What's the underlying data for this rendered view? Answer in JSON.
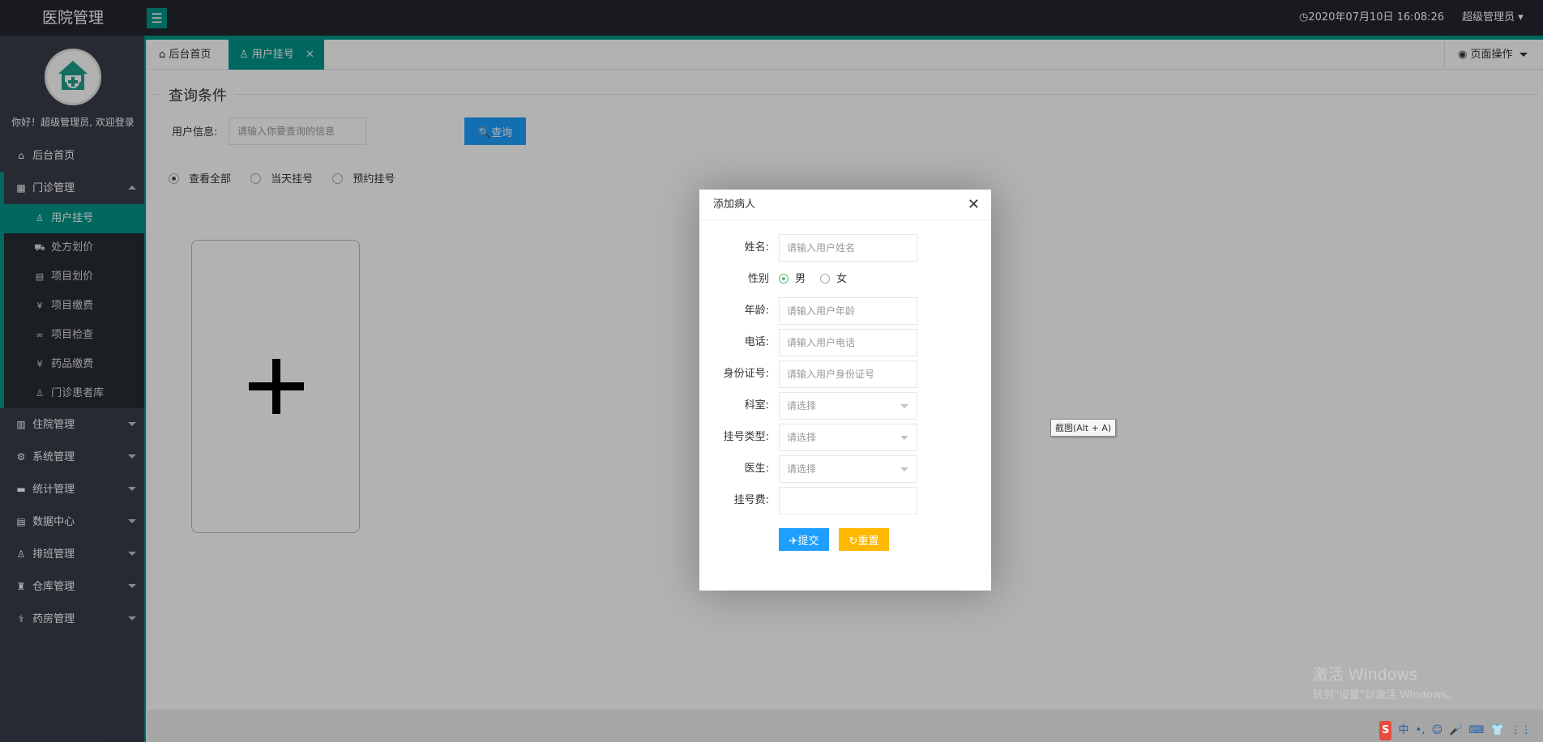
{
  "header": {
    "app_title": "医院管理",
    "menu_toggle_glyph": "☰",
    "datetime": "◷2020年07月10日 16:08:26",
    "user_menu": "超级管理员 ▾"
  },
  "sidebar": {
    "welcome": "你好！超级管理员, 欢迎登录",
    "items": [
      {
        "icon": "⌂",
        "label": "后台首页"
      },
      {
        "icon": "▦",
        "label": "门诊管理"
      },
      {
        "icon": "▥",
        "label": "住院管理"
      },
      {
        "icon": "⚙",
        "label": "系统管理"
      },
      {
        "icon": "▬",
        "label": "统计管理"
      },
      {
        "icon": "▤",
        "label": "数据中心"
      },
      {
        "icon": "♙",
        "label": "排班管理"
      },
      {
        "icon": "♜",
        "label": "仓库管理"
      },
      {
        "icon": "⚕",
        "label": "药房管理"
      }
    ],
    "subitems": [
      {
        "icon": "♙",
        "label": "用户挂号"
      },
      {
        "icon": "⛟",
        "label": "处方划价"
      },
      {
        "icon": "▤",
        "label": "项目划价"
      },
      {
        "icon": "¥",
        "label": "项目缴费"
      },
      {
        "icon": "∞",
        "label": "项目检查"
      },
      {
        "icon": "¥",
        "label": "药品缴费"
      },
      {
        "icon": "♙",
        "label": "门诊患者库"
      }
    ]
  },
  "tabs": {
    "home_icon": "⌂",
    "home_label": "后台首页",
    "active_icon": "♙",
    "active_label": "用户挂号",
    "close_glyph": "✕",
    "page_ops_icon": "◉",
    "page_ops_label": "页面操作"
  },
  "query": {
    "legend": "查询条件",
    "user_info_label": "用户信息:",
    "user_info_placeholder": "请输入你要查询的信息",
    "query_button": "🔍查询",
    "radios": [
      "查看全部",
      "当天挂号",
      "预约挂号"
    ]
  },
  "modal": {
    "title": "添加病人",
    "close_glyph": "✕",
    "name_label": "姓名:",
    "name_placeholder": "请输入用户姓名",
    "gender_label": "性别",
    "gender_male": "男",
    "gender_female": "女",
    "age_label": "年龄:",
    "age_placeholder": "请输入用户年龄",
    "phone_label": "电话:",
    "phone_placeholder": "请输入用户电话",
    "id_label": "身份证号:",
    "id_placeholder": "请输入用户身份证号",
    "dept_label": "科室:",
    "dept_value": "请选择",
    "regtype_label": "挂号类型:",
    "regtype_value": "请选择",
    "doctor_label": "医生:",
    "doctor_value": "请选择",
    "fee_label": "挂号费:",
    "submit_button": "✈提交",
    "reset_button": "↻重置"
  },
  "tooltip": "截图(Alt + A)",
  "watermark": {
    "line1": "激活 Windows",
    "line2": "转到\"设置\"以激活 Windows。"
  },
  "tray": [
    "S",
    "中",
    "•,",
    "☺",
    "🎤",
    "⌨",
    "👕",
    "⋮⋮"
  ]
}
